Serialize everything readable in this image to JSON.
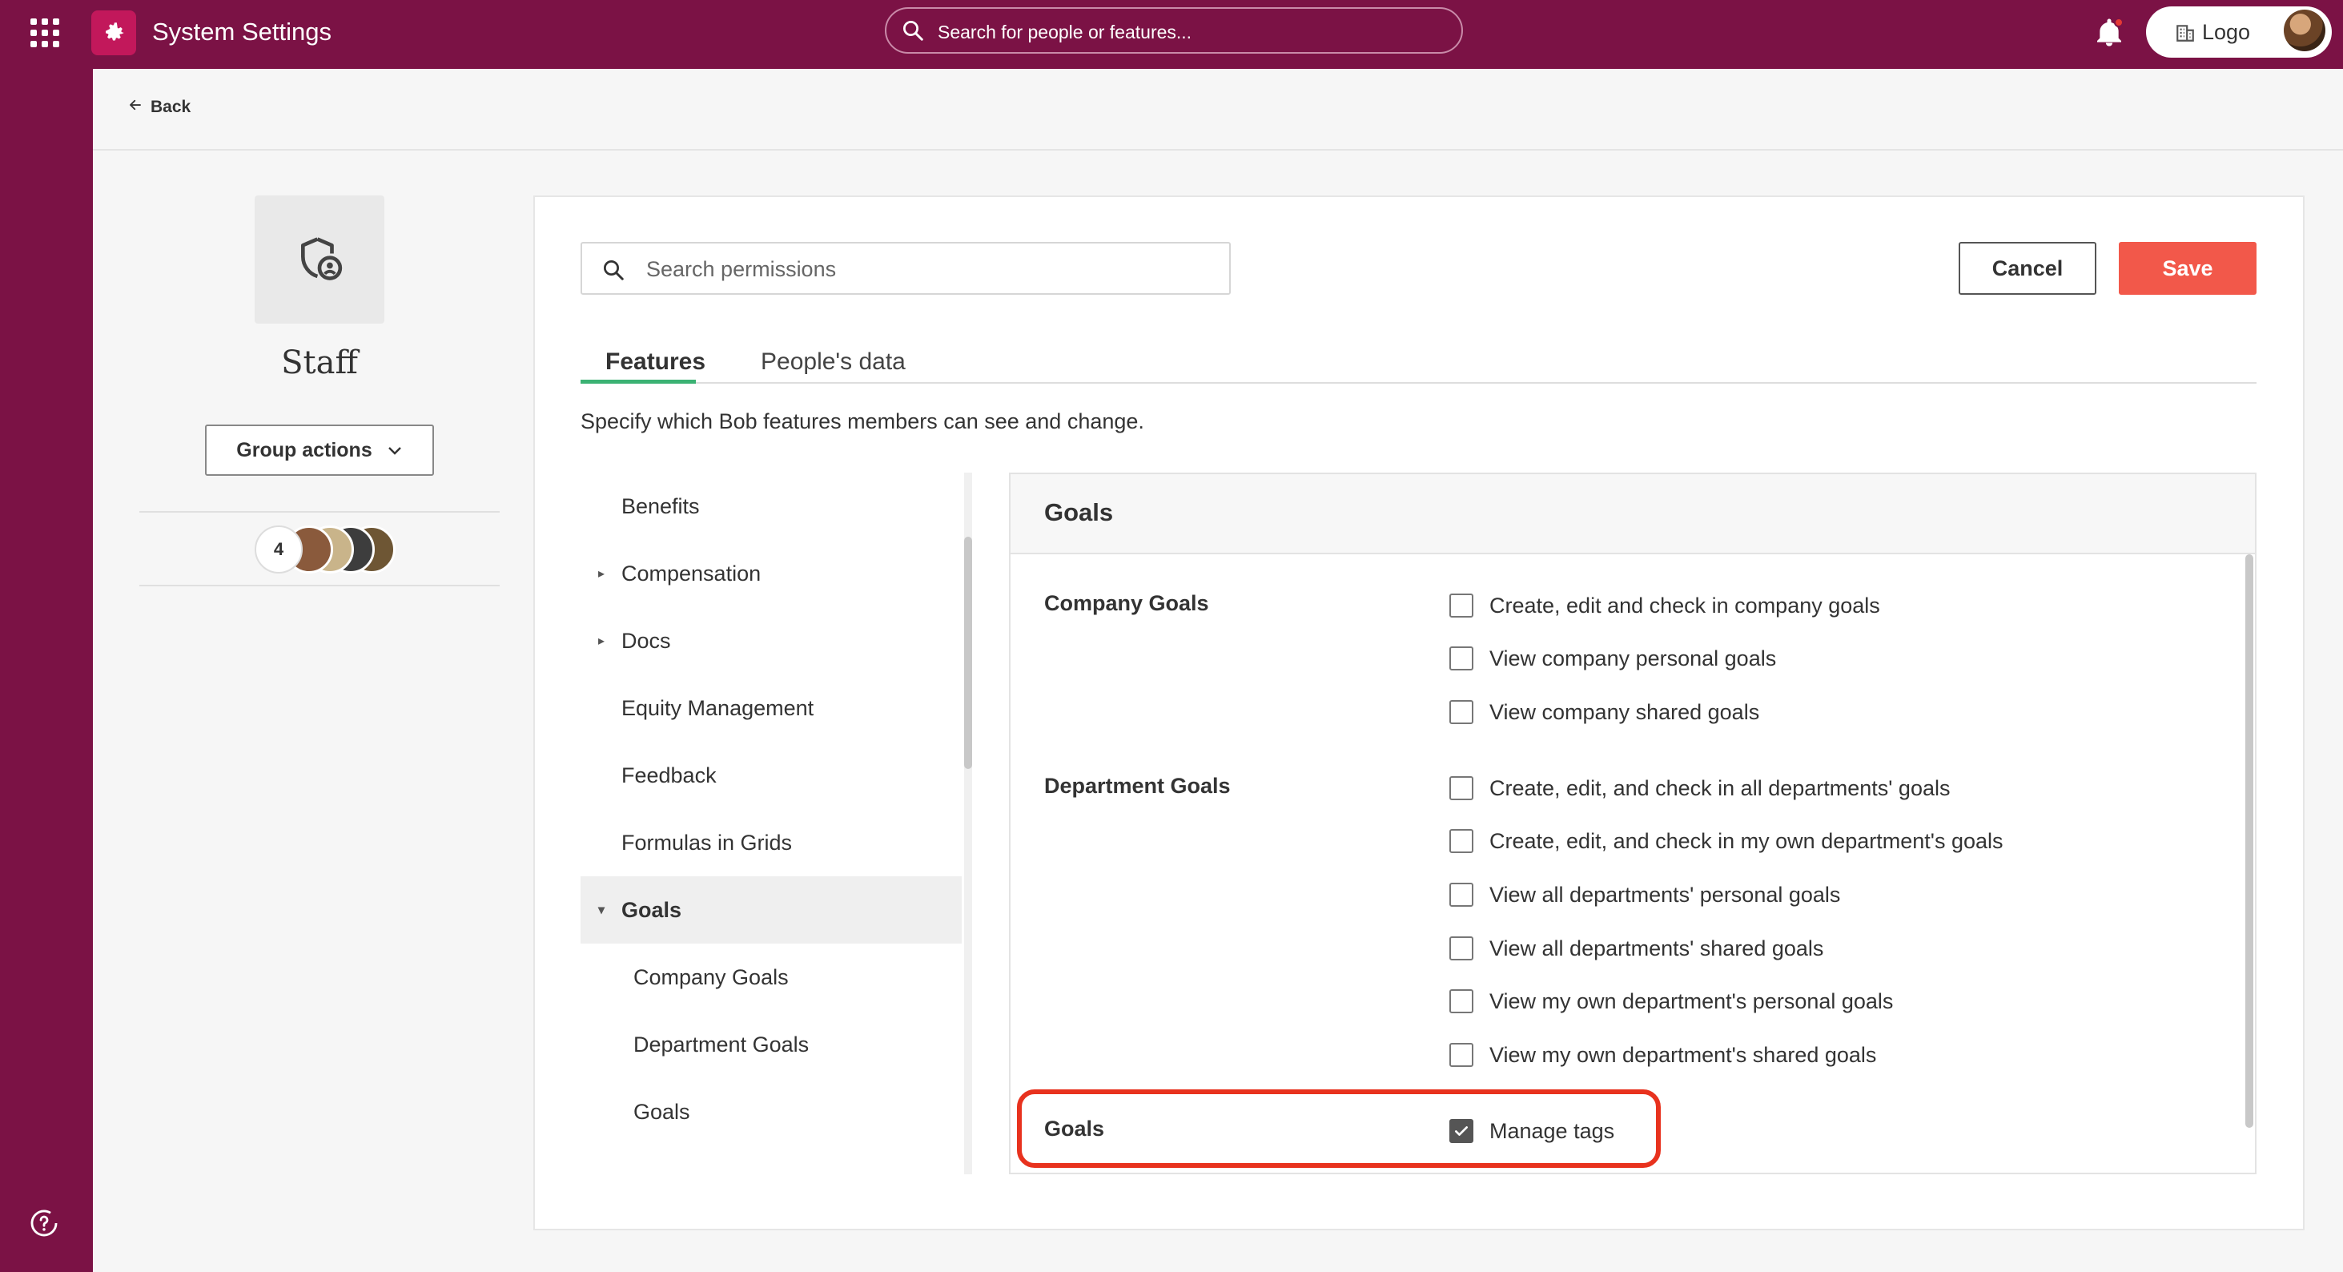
{
  "app": {
    "title": "System Settings",
    "search_placeholder": "Search for people or features...",
    "org_button_label": "Logo",
    "brand_color": "#7b1245",
    "accent_color": "#f2584a"
  },
  "nav": {
    "back_label": "Back"
  },
  "group": {
    "name": "Staff",
    "actions_label": "Group actions",
    "member_count": "4"
  },
  "search": {
    "placeholder": "Search permissions"
  },
  "buttons": {
    "cancel": "Cancel",
    "save": "Save"
  },
  "tabs": [
    {
      "label": "Features",
      "active": true
    },
    {
      "label": "People's data",
      "active": false
    }
  ],
  "description": "Specify which Bob features members can see and change.",
  "feature_list": [
    {
      "label": "Benefits",
      "caret": ""
    },
    {
      "label": "Compensation",
      "caret": "▸"
    },
    {
      "label": "Docs",
      "caret": "▸"
    },
    {
      "label": "Equity Management",
      "caret": ""
    },
    {
      "label": "Feedback",
      "caret": ""
    },
    {
      "label": "Formulas in Grids",
      "caret": ""
    },
    {
      "label": "Goals",
      "caret": "▾"
    },
    {
      "label": "Company Goals",
      "caret": ""
    },
    {
      "label": "Department Goals",
      "caret": ""
    },
    {
      "label": "Goals",
      "caret": ""
    }
  ],
  "panel": {
    "title": "Goals",
    "sections": [
      {
        "label": "Company Goals",
        "permissions": [
          {
            "label": "Create, edit and check in company goals",
            "checked": false
          },
          {
            "label": "View company personal goals",
            "checked": false
          },
          {
            "label": "View company shared goals",
            "checked": false
          }
        ]
      },
      {
        "label": "Department Goals",
        "permissions": [
          {
            "label": "Create, edit, and check in all departments' goals",
            "checked": false
          },
          {
            "label": "Create, edit, and check in my own department's goals",
            "checked": false
          },
          {
            "label": "View all departments' personal goals",
            "checked": false
          },
          {
            "label": "View all departments' shared goals",
            "checked": false
          },
          {
            "label": "View my own department's personal goals",
            "checked": false
          },
          {
            "label": "View my own department's shared goals",
            "checked": false
          }
        ]
      },
      {
        "label": "Goals",
        "permissions": [
          {
            "label": "Manage tags",
            "checked": true
          }
        ]
      }
    ]
  }
}
